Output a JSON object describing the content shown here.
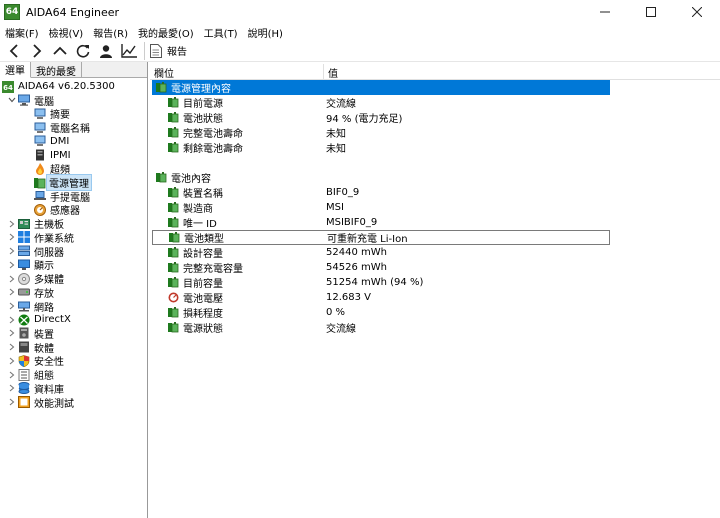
{
  "window": {
    "app_icon": "64",
    "title": "AIDA64 Engineer"
  },
  "menu": [
    "檔案(F)",
    "檢視(V)",
    "報告(R)",
    "我的最愛(O)",
    "工具(T)",
    "說明(H)"
  ],
  "toolbar": {
    "report_label": "報告"
  },
  "left_tabs": [
    "選單",
    "我的最愛"
  ],
  "tree": [
    {
      "label": "AIDA64 v6.20.5300",
      "icon": "aida64-icon",
      "level": 0
    },
    {
      "label": "電腦",
      "icon": "computer-icon",
      "level": 1,
      "expand": "open"
    },
    {
      "label": "摘要",
      "icon": "summary-icon",
      "level": 2
    },
    {
      "label": "電腦名稱",
      "icon": "computer-name-icon",
      "level": 2
    },
    {
      "label": "DMI",
      "icon": "dmi-icon",
      "level": 2
    },
    {
      "label": "IPMI",
      "icon": "ipmi-icon",
      "level": 2
    },
    {
      "label": "超頻",
      "icon": "overclock-icon",
      "level": 2
    },
    {
      "label": "電源管理",
      "icon": "power-management-icon",
      "level": 2,
      "selected": true
    },
    {
      "label": "手提電腦",
      "icon": "laptop-icon",
      "level": 2
    },
    {
      "label": "感應器",
      "icon": "sensor-icon",
      "level": 2
    },
    {
      "label": "主機板",
      "icon": "motherboard-icon",
      "level": 1,
      "expand": "closed"
    },
    {
      "label": "作業系統",
      "icon": "windows-icon",
      "level": 1,
      "expand": "closed"
    },
    {
      "label": "伺服器",
      "icon": "server-icon",
      "level": 1,
      "expand": "closed"
    },
    {
      "label": "顯示",
      "icon": "display-icon",
      "level": 1,
      "expand": "closed"
    },
    {
      "label": "多媒體",
      "icon": "multimedia-icon",
      "level": 1,
      "expand": "closed"
    },
    {
      "label": "存放",
      "icon": "storage-icon",
      "level": 1,
      "expand": "closed"
    },
    {
      "label": "網路",
      "icon": "network-icon",
      "level": 1,
      "expand": "closed"
    },
    {
      "label": "DirectX",
      "icon": "xbox-icon",
      "level": 1,
      "expand": "closed"
    },
    {
      "label": "裝置",
      "icon": "devices-icon",
      "level": 1,
      "expand": "closed"
    },
    {
      "label": "軟體",
      "icon": "software-icon",
      "level": 1,
      "expand": "closed"
    },
    {
      "label": "安全性",
      "icon": "security-shield-icon",
      "level": 1,
      "expand": "closed"
    },
    {
      "label": "組態",
      "icon": "config-icon",
      "level": 1,
      "expand": "closed"
    },
    {
      "label": "資料庫",
      "icon": "database-icon",
      "level": 1,
      "expand": "closed"
    },
    {
      "label": "效能測試",
      "icon": "benchmark-icon",
      "level": 1,
      "expand": "closed"
    }
  ],
  "columns": {
    "field": "欄位",
    "value": "值"
  },
  "rows": [
    {
      "type": "section",
      "field": "電源管理內容",
      "value": "",
      "icon": "battery-icon",
      "highlight": true
    },
    {
      "type": "child",
      "field": "目前電源",
      "value": "交流線",
      "icon": "battery-icon"
    },
    {
      "type": "child",
      "field": "電池狀態",
      "value": "94 % (電力充足)",
      "icon": "battery-icon"
    },
    {
      "type": "child",
      "field": "完整電池壽命",
      "value": "未知",
      "icon": "battery-icon"
    },
    {
      "type": "child",
      "field": "剩餘電池壽命",
      "value": "未知",
      "icon": "battery-icon"
    },
    {
      "type": "blank"
    },
    {
      "type": "section",
      "field": "電池內容",
      "value": "",
      "icon": "battery-icon"
    },
    {
      "type": "child",
      "field": "裝置名稱",
      "value": "BIF0_9",
      "icon": "battery-icon"
    },
    {
      "type": "child",
      "field": "製造商",
      "value": "MSI",
      "icon": "battery-icon"
    },
    {
      "type": "child",
      "field": "唯一 ID",
      "value": "MSIBIF0_9",
      "icon": "battery-icon"
    },
    {
      "type": "child",
      "field": "電池類型",
      "value": "可重新充電 Li-Ion",
      "icon": "battery-icon",
      "boxed": true
    },
    {
      "type": "child",
      "field": "設計容量",
      "value": "52440 mWh",
      "icon": "battery-icon"
    },
    {
      "type": "child",
      "field": "完整充電容量",
      "value": "54526 mWh",
      "icon": "battery-icon"
    },
    {
      "type": "child",
      "field": "目前容量",
      "value": "51254 mWh  (94 %)",
      "icon": "battery-icon"
    },
    {
      "type": "child",
      "field": "電池電壓",
      "value": "12.683 V",
      "icon": "voltage-gauge-icon"
    },
    {
      "type": "child",
      "field": "損耗程度",
      "value": "0 %",
      "icon": "battery-icon"
    },
    {
      "type": "child",
      "field": "電源狀態",
      "value": "交流線",
      "icon": "battery-icon"
    }
  ]
}
